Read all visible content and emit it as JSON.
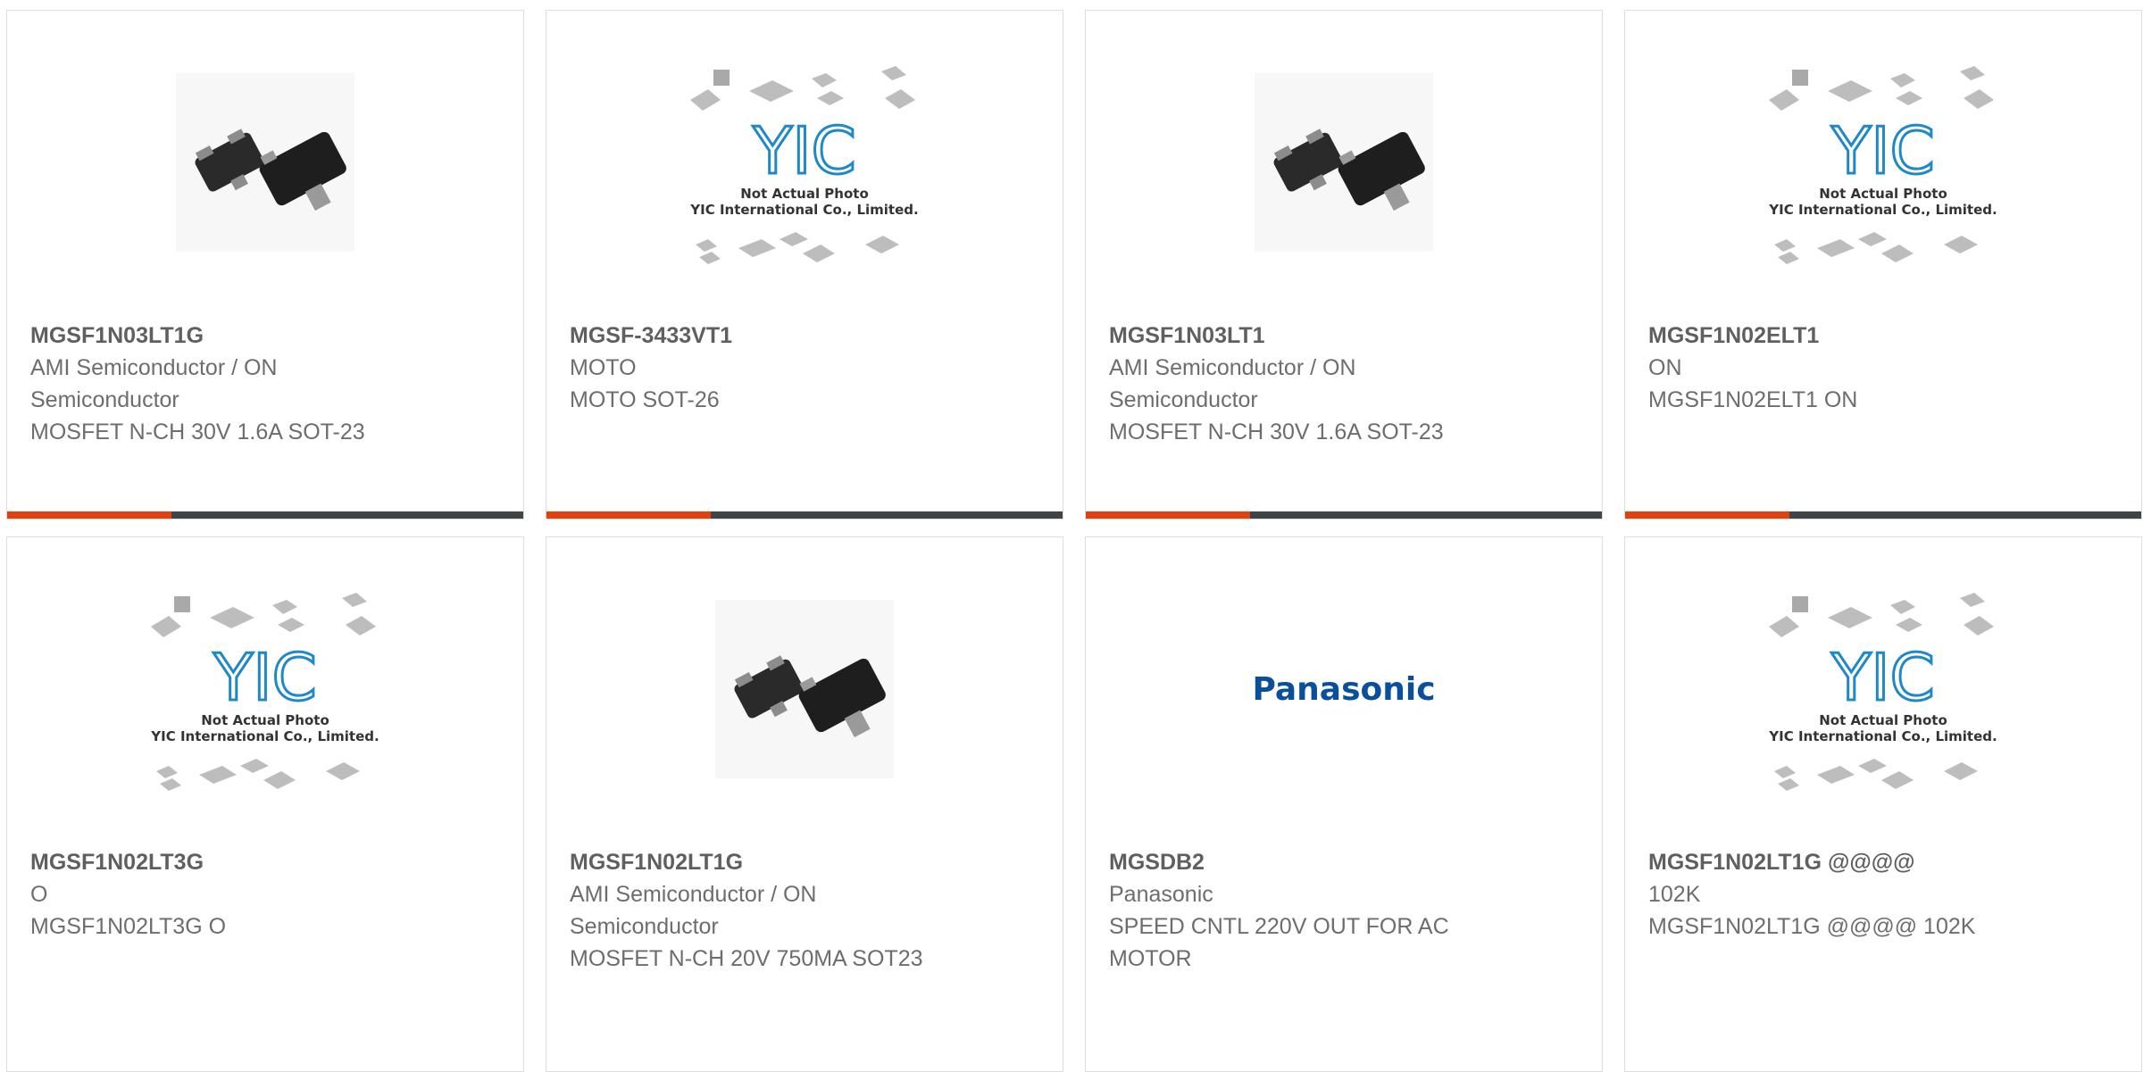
{
  "products": [
    {
      "part": "MGSF1N03LT1G",
      "brand": "AMI Semiconductor / ON Semiconductor",
      "desc": "MOSFET N-CH 30V 1.6A SOT-23",
      "image": "sot23-photo"
    },
    {
      "part": "MGSF-3433VT1",
      "brand": "MOTO",
      "desc": "MOTO SOT-26",
      "image": "yic-placeholder"
    },
    {
      "part": "MGSF1N03LT1",
      "brand": "AMI Semiconductor / ON Semiconductor",
      "desc": "MOSFET N-CH 30V 1.6A SOT-23",
      "image": "sot23-photo"
    },
    {
      "part": "MGSF1N02ELT1",
      "brand": "ON",
      "desc": "MGSF1N02ELT1 ON",
      "image": "yic-placeholder"
    },
    {
      "part": "MGSF1N02LT3G",
      "brand": "O",
      "desc": "MGSF1N02LT3G O",
      "image": "yic-placeholder"
    },
    {
      "part": "MGSF1N02LT1G",
      "brand": "AMI Semiconductor / ON Semiconductor",
      "desc": "MOSFET N-CH 20V 750MA SOT23",
      "image": "sot23-photo"
    },
    {
      "part": "MGSDB2",
      "brand": "Panasonic",
      "desc": "SPEED CNTL 220V OUT FOR AC MOTOR",
      "image": "panasonic-logo"
    },
    {
      "part": "MGSF1N02LT1G @@@@",
      "brand": "102K",
      "desc": "MGSF1N02LT1G @@@@ 102K",
      "image": "yic-placeholder"
    }
  ],
  "placeholder_text": {
    "line1": "Not Actual Photo",
    "line2": "YIC International Co., Limited.",
    "logo": "YIC"
  },
  "logo_text": {
    "panasonic": "Panasonic"
  },
  "colors": {
    "accent": "#e1400f",
    "bar": "#3f4447",
    "yic_blue": "#1e88c8",
    "panasonic_blue": "#0a4f9c"
  }
}
